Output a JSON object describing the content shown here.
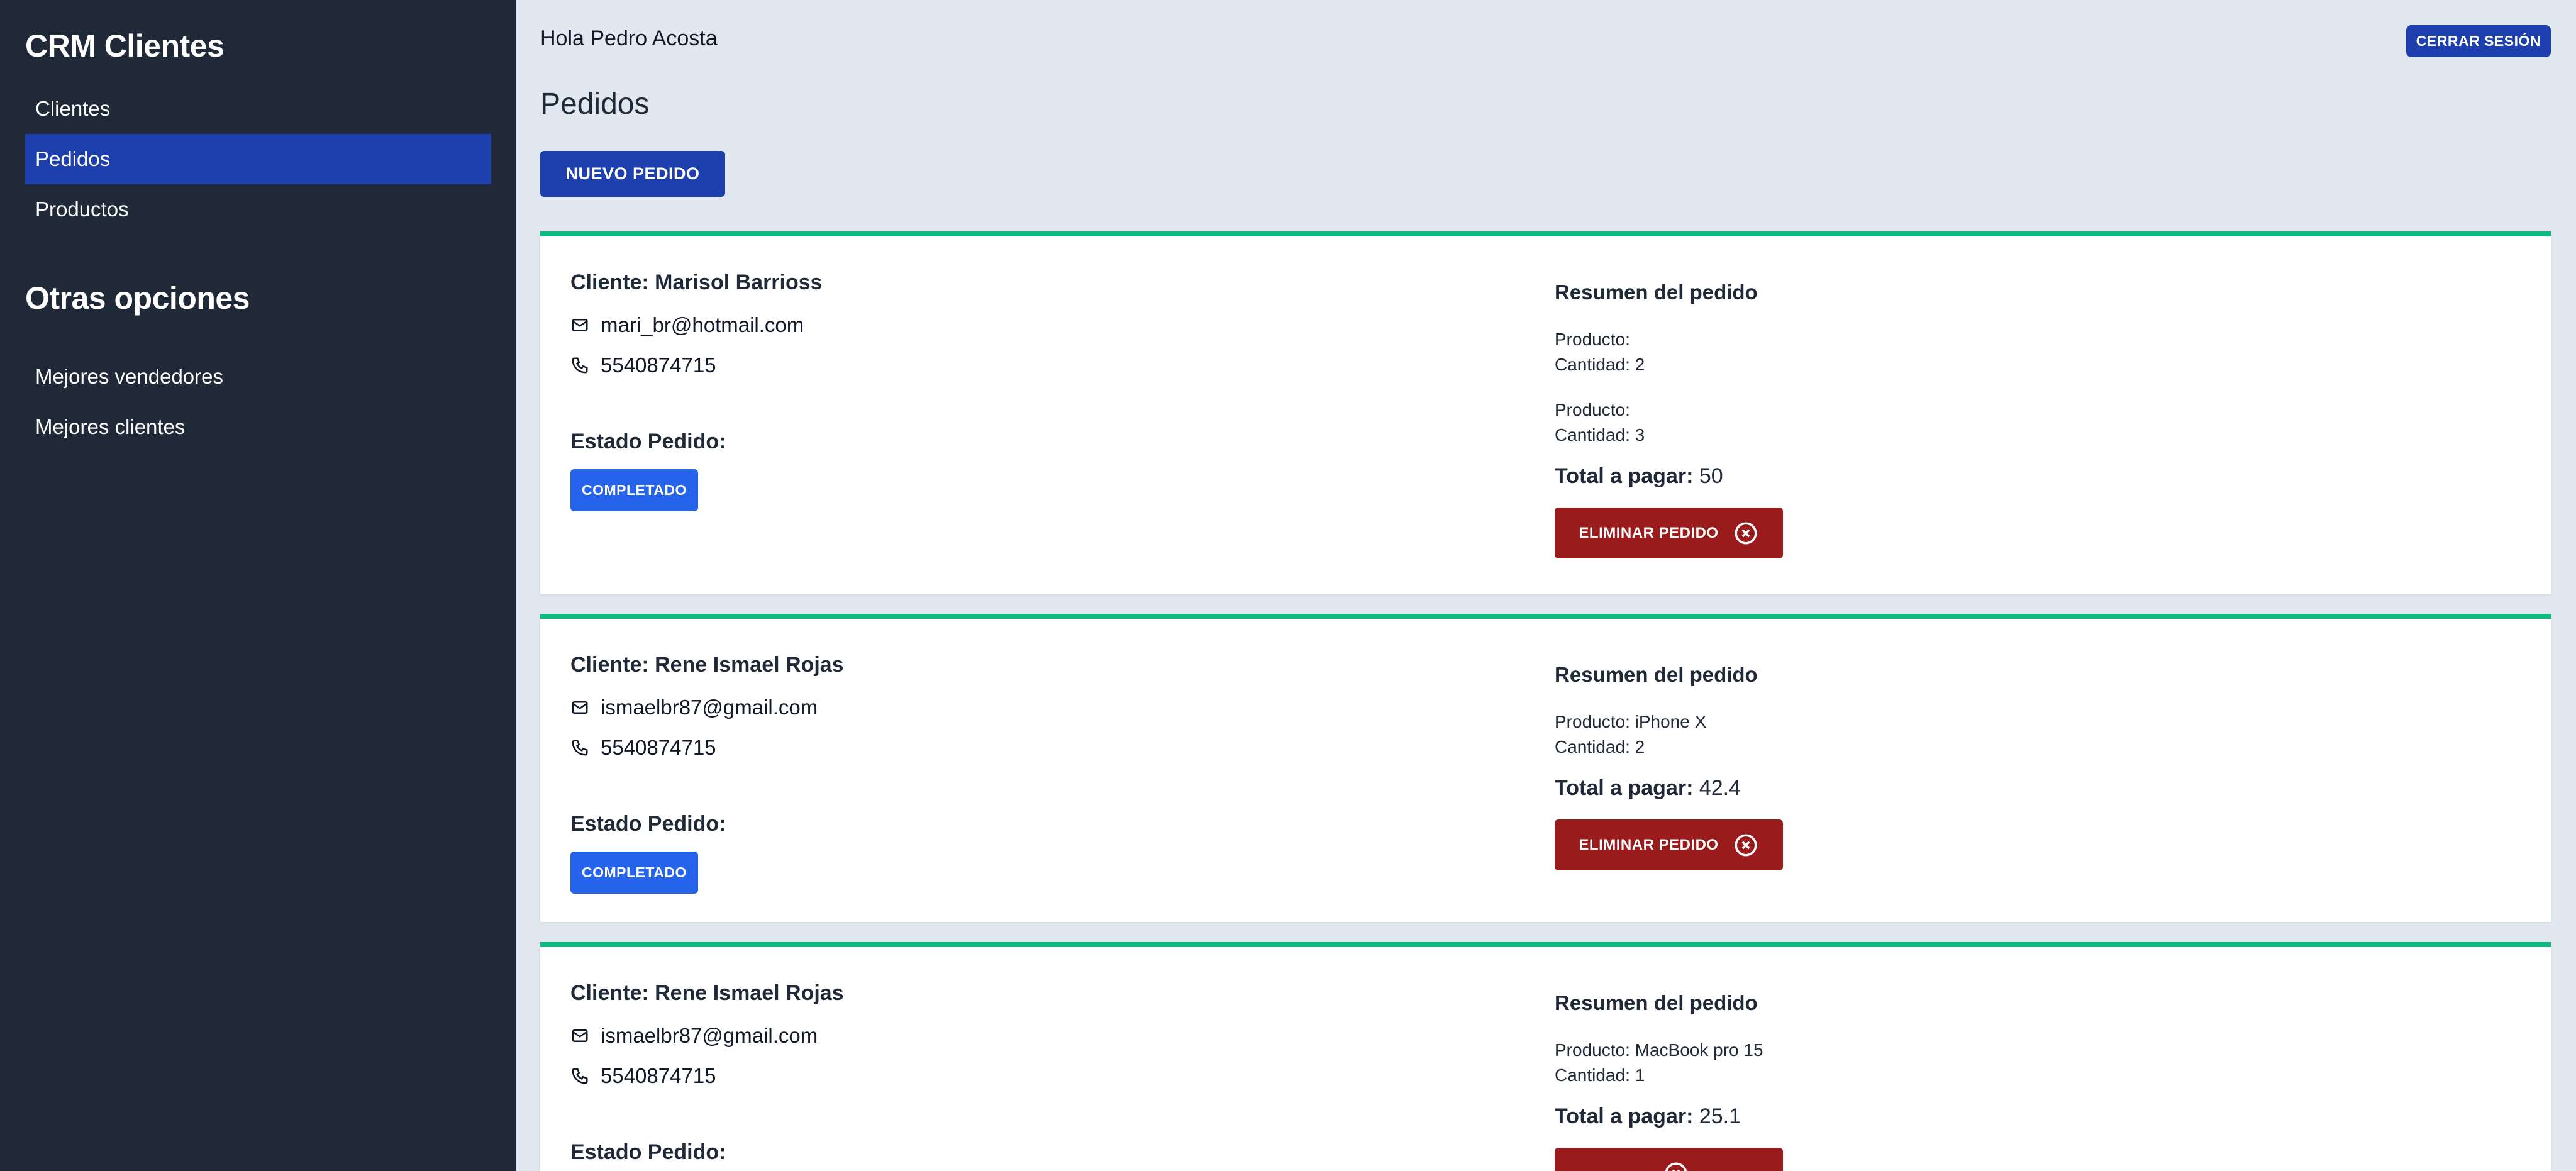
{
  "sidebar": {
    "brand": "CRM Clientes",
    "nav": [
      {
        "label": "Clientes"
      },
      {
        "label": "Pedidos"
      },
      {
        "label": "Productos"
      }
    ],
    "other_title": "Otras opciones",
    "other": [
      {
        "label": "Mejores vendedores"
      },
      {
        "label": "Mejores clientes"
      }
    ]
  },
  "header": {
    "greeting": "Hola Pedro Acosta",
    "logout_label": "CERRAR SESIÓN"
  },
  "page": {
    "title": "Pedidos",
    "new_order_label": "NUEVO PEDIDO"
  },
  "orders": [
    {
      "client": "Cliente: Marisol Barrioss",
      "email": "mari_br@hotmail.com",
      "phone": "5540874715",
      "estado_label": "Estado Pedido:",
      "status": "COMPLETADO",
      "summary_title": "Resumen del pedido",
      "products": [
        {
          "producto": "Producto: ",
          "cantidad": "Cantidad: 2"
        },
        {
          "producto": "Producto: ",
          "cantidad": "Cantidad: 3"
        }
      ],
      "total_label": "Total a pagar:",
      "total_value": "50",
      "delete_label": "ELIMINAR PEDIDO"
    },
    {
      "client": "Cliente: Rene Ismael Rojas",
      "email": "ismaelbr87@gmail.com",
      "phone": "5540874715",
      "estado_label": "Estado Pedido:",
      "status": "COMPLETADO",
      "summary_title": "Resumen del pedido",
      "products": [
        {
          "producto": "Producto: iPhone X",
          "cantidad": "Cantidad: 2"
        }
      ],
      "total_label": "Total a pagar:",
      "total_value": "42.4",
      "delete_label": "ELIMINAR PEDIDO"
    },
    {
      "client": "Cliente: Rene Ismael Rojas",
      "email": "ismaelbr87@gmail.com",
      "phone": "5540874715",
      "estado_label": "Estado Pedido:",
      "status": "",
      "summary_title": "Resumen del pedido",
      "products": [
        {
          "producto": "Producto: MacBook pro 15",
          "cantidad": "Cantidad: 1"
        }
      ],
      "total_label": "Total a pagar:",
      "total_value": "25.1",
      "delete_label": ""
    }
  ],
  "colors": {
    "sidebar_bg": "#1f2937",
    "active_nav": "#1e40af",
    "page_bg": "#e2e8f0",
    "card_border": "#10b981",
    "status_badge": "#2563eb",
    "delete_button": "#991b1b"
  }
}
